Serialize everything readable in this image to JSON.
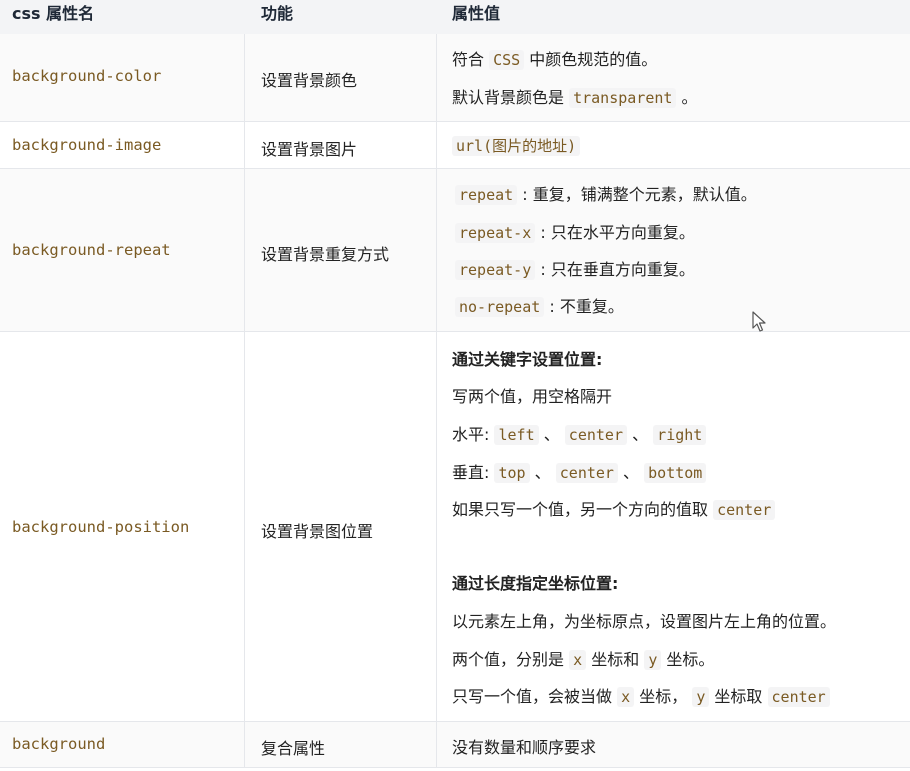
{
  "headers": {
    "property": "css 属性名",
    "function": "功能",
    "value": "属性值"
  },
  "rows": [
    {
      "property": "background-color",
      "function": "设置背景颜色",
      "lines": [
        {
          "pre": "符合 ",
          "code": "CSS",
          "post": " 中颜色规范的值。"
        },
        {
          "pre": "默认背景颜色是 ",
          "code": "transparent",
          "post": " 。"
        }
      ]
    },
    {
      "property": "background-image",
      "function": "设置背景图片",
      "lines": [
        {
          "pre": "",
          "code": "url(图片的地址)",
          "post": ""
        }
      ]
    },
    {
      "property": "background-repeat",
      "function": "设置背景重复方式",
      "lines": [
        {
          "pre": "",
          "code": "repeat",
          "post": " : 重复，铺满整个元素，默认值。"
        },
        {
          "pre": "",
          "code": "repeat-x",
          "post": " : 只在水平方向重复。"
        },
        {
          "pre": "",
          "code": "repeat-y",
          "post": " : 只在垂直方向重复。"
        },
        {
          "pre": "",
          "code": "no-repeat",
          "post": " : 不重复。"
        }
      ]
    },
    {
      "property": "background-position",
      "function": "设置背景图位置",
      "keyword_title": "通过关键字设置位置:",
      "kw_line1": "写两个值，用空格隔开",
      "kw_line2": {
        "pre": "水平: ",
        "c1": "left",
        "s1": " 、 ",
        "c2": "center",
        "s2": " 、 ",
        "c3": "right"
      },
      "kw_line3": {
        "pre": "垂直: ",
        "c1": "top",
        "s1": " 、 ",
        "c2": "center",
        "s2": " 、 ",
        "c3": "bottom"
      },
      "kw_line4": {
        "pre": "如果只写一个值，另一个方向的值取 ",
        "code": "center"
      },
      "length_title": "通过长度指定坐标位置:",
      "len_line1": "以元素左上角，为坐标原点，设置图片左上角的位置。",
      "len_line2": {
        "pre": "两个值，分别是 ",
        "c1": "x",
        "mid": " 坐标和 ",
        "c2": "y",
        "post": " 坐标。"
      },
      "len_line3": {
        "pre": "只写一个值，会被当做 ",
        "c1": "x",
        "mid": " 坐标， ",
        "c2": "y",
        "post": " 坐标取 ",
        "c3": "center"
      }
    },
    {
      "property": "background",
      "function": "复合属性",
      "lines": [
        {
          "pre": "没有数量和顺序要求",
          "code": "",
          "post": ""
        }
      ]
    }
  ]
}
